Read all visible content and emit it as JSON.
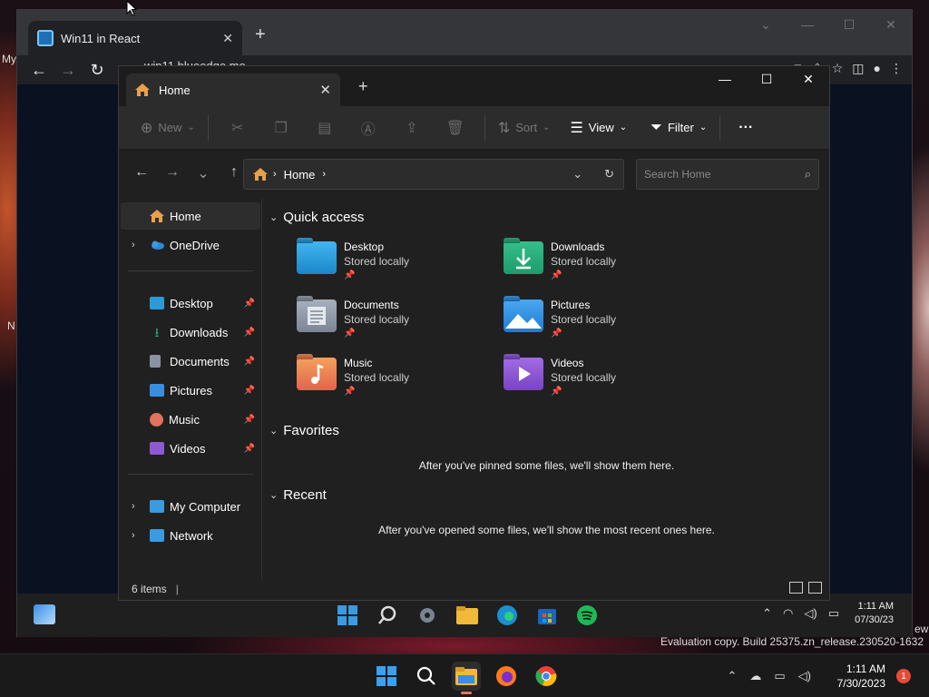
{
  "host_desktop": {
    "labels": [
      "My",
      "N",
      "ew"
    ]
  },
  "chrome": {
    "tab_title": "Win11 in React",
    "url": "win11.blueedge.me"
  },
  "explorer": {
    "tab_title": "Home",
    "cmdbar": {
      "new_label": "New",
      "sort_label": "Sort",
      "view_label": "View",
      "filter_label": "Filter",
      "more_label": "···"
    },
    "address": {
      "crumb": "Home",
      "search_placeholder": "Search Home"
    },
    "sidebar": {
      "top": [
        {
          "label": "Home",
          "icon": "home-icon",
          "color": "#e8a04a"
        },
        {
          "label": "OneDrive",
          "icon": "cloud-icon",
          "color": "#2a8ad4"
        }
      ],
      "pinned": [
        {
          "label": "Desktop",
          "icon": "desktop-folder-icon",
          "color": "#2c9ad6"
        },
        {
          "label": "Downloads",
          "icon": "downloads-folder-icon",
          "color": "#2ba37a"
        },
        {
          "label": "Documents",
          "icon": "documents-folder-icon",
          "color": "#8a93a3"
        },
        {
          "label": "Pictures",
          "icon": "pictures-folder-icon",
          "color": "#3a8ee0"
        },
        {
          "label": "Music",
          "icon": "music-folder-icon",
          "color": "#e2725b"
        },
        {
          "label": "Videos",
          "icon": "videos-folder-icon",
          "color": "#8e5ad4"
        }
      ],
      "bottom": [
        {
          "label": "My Computer",
          "icon": "computer-icon",
          "color": "#3a9be0"
        },
        {
          "label": "Network",
          "icon": "network-icon",
          "color": "#3a9be0"
        }
      ]
    },
    "sections": {
      "quick_access": "Quick access",
      "favorites": "Favorites",
      "recent": "Recent"
    },
    "quick_access": [
      {
        "name": "Desktop",
        "sub": "Stored locally",
        "icon": "desktop-folder-icon",
        "color": "#2c9ad6"
      },
      {
        "name": "Downloads",
        "sub": "Stored locally",
        "icon": "downloads-folder-icon",
        "color": "#2ba37a"
      },
      {
        "name": "Documents",
        "sub": "Stored locally",
        "icon": "documents-folder-icon",
        "color": "#8a93a3"
      },
      {
        "name": "Pictures",
        "sub": "Stored locally",
        "icon": "pictures-folder-icon",
        "color": "#3a8ee0"
      },
      {
        "name": "Music",
        "sub": "Stored locally",
        "icon": "music-folder-icon",
        "color": "#e2725b"
      },
      {
        "name": "Videos",
        "sub": "Stored locally",
        "icon": "videos-folder-icon",
        "color": "#8e5ad4"
      }
    ],
    "favorites_empty": "After you've pinned some files, we'll show them here.",
    "recent_empty": "After you've opened some files, we'll show the most recent ones here.",
    "status": "6 items"
  },
  "web_taskbar": {
    "time": "1:11 AM",
    "date": "07/30/23"
  },
  "host": {
    "eval_text": "Evaluation copy. Build 25375.zn_release.230520-1632",
    "time": "1:11 AM",
    "date": "7/30/2023",
    "notifications": "1"
  }
}
